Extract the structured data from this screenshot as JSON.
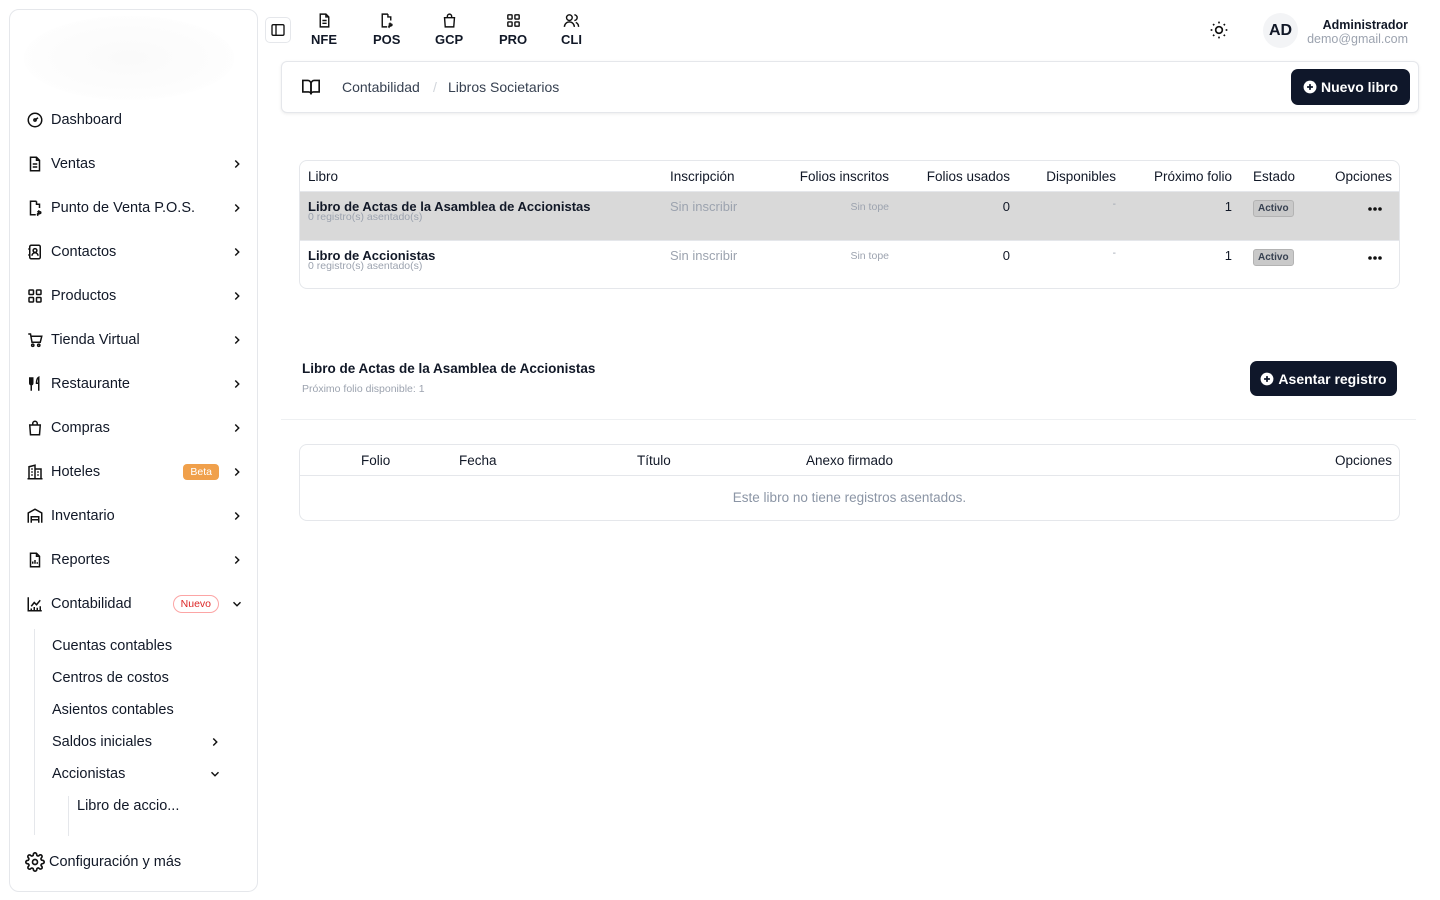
{
  "sidebar": {
    "items": [
      {
        "label": "Dashboard",
        "icon": "dashboard-icon"
      },
      {
        "label": "Ventas",
        "icon": "document-icon"
      },
      {
        "label": "Punto de Venta P.O.S.",
        "icon": "receipt-icon"
      },
      {
        "label": "Contactos",
        "icon": "contacts-icon"
      },
      {
        "label": "Productos",
        "icon": "grid-icon"
      },
      {
        "label": "Tienda Virtual",
        "icon": "cart-icon"
      },
      {
        "label": "Restaurante",
        "icon": "utensils-icon"
      },
      {
        "label": "Compras",
        "icon": "shopping-bag-icon"
      },
      {
        "label": "Hoteles",
        "icon": "building-icon",
        "badge": "Beta"
      },
      {
        "label": "Inventario",
        "icon": "warehouse-icon"
      },
      {
        "label": "Reportes",
        "icon": "report-icon"
      },
      {
        "label": "Contabilidad",
        "icon": "chart-icon",
        "badge": "Nuevo"
      }
    ],
    "sub_items": [
      "Cuentas contables",
      "Centros de costos",
      "Asientos contables",
      "Saldos iniciales",
      "Accionistas"
    ],
    "sub_sub_item": "Libro de accio...",
    "settings": "Configuración y más"
  },
  "topbar": {
    "modules": [
      "NFE",
      "POS",
      "GCP",
      "PRO",
      "CLI"
    ],
    "avatar": "AD",
    "user_name": "Administrador",
    "user_email": "demo@gmail.com"
  },
  "breadcrumb": {
    "items": [
      "Contabilidad",
      "Libros Societarios"
    ],
    "separator": "/",
    "new_button": "Nuevo libro"
  },
  "books_table": {
    "headers": [
      "Libro",
      "Inscripción",
      "Folios inscritos",
      "Folios usados",
      "Disponibles",
      "Próximo folio",
      "Estado",
      "Opciones"
    ],
    "rows": [
      {
        "name": "Libro de Actas de la Asamblea de Accionistas",
        "sub": "0 registro(s) asentado(s)",
        "inscripcion": "Sin inscribir",
        "folios_inscritos": "Sin tope",
        "folios_usados": "0",
        "disponibles": "-",
        "proximo": "1",
        "estado": "Activo"
      },
      {
        "name": "Libro de Accionistas",
        "sub": "0 registro(s) asentado(s)",
        "inscripcion": "Sin inscribir",
        "folios_inscritos": "Sin tope",
        "folios_usados": "0",
        "disponibles": "-",
        "proximo": "1",
        "estado": "Activo"
      }
    ]
  },
  "detail": {
    "title": "Libro de Actas de la Asamblea de Accionistas",
    "subtitle": "Próximo folio disponible: 1",
    "button": "Asentar registro"
  },
  "records_table": {
    "headers": [
      "Folio",
      "Fecha",
      "Título",
      "Anexo firmado",
      "Opciones"
    ],
    "empty": "Este libro no tiene registros asentados."
  },
  "colors": {
    "primary": "#0f172a",
    "beta": "#f0a04b",
    "nuevo": "#dc2626",
    "selected_row": "#d9d9d9"
  }
}
